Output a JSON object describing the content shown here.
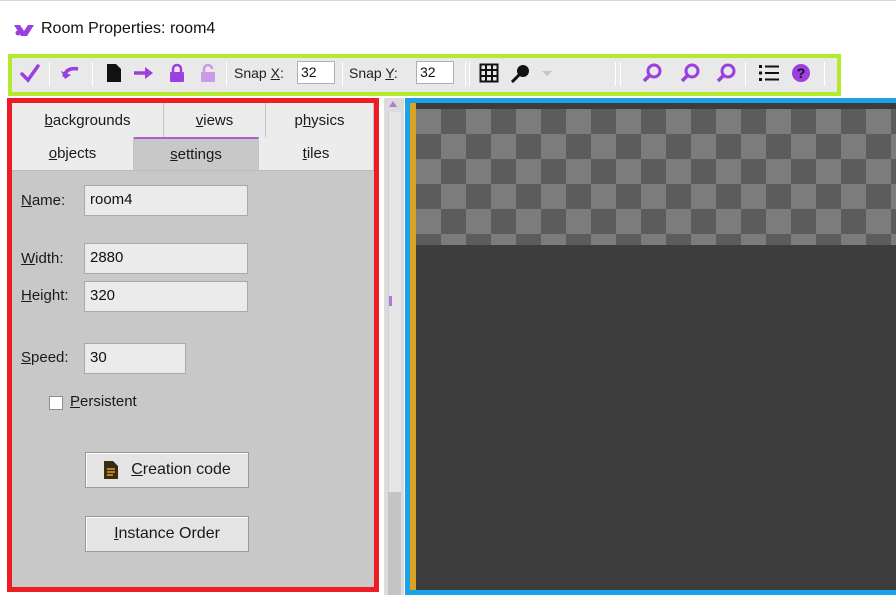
{
  "window": {
    "title": "Room Properties: room4"
  },
  "toolbar": {
    "buttons": [
      {
        "name": "ok-check-icon"
      },
      {
        "name": "undo-icon"
      },
      {
        "name": "clear-document-icon"
      },
      {
        "name": "shift-arrow-icon"
      },
      {
        "name": "lock-icon"
      },
      {
        "name": "unlock-icon"
      }
    ],
    "snap_x": {
      "label_pre": "Snap ",
      "label_key": "X",
      "label_post": ":",
      "value": "32"
    },
    "snap_y": {
      "label_pre": "Snap ",
      "label_key": "Y",
      "label_post": ":",
      "value": "32"
    },
    "grid_icon": "grid-icon",
    "zoom_icons": [
      "zoom-out-icon",
      "zoom-normal-icon",
      "zoom-in-icon"
    ],
    "list_icon": "list-icon",
    "help_icon": "help-icon",
    "accent": "#9b3fe0"
  },
  "tabs": {
    "row1": [
      {
        "pre": "",
        "key": "b",
        "post": "ackgrounds"
      },
      {
        "pre": "",
        "key": "v",
        "post": "iews"
      },
      {
        "pre": "p",
        "key": "h",
        "post": "ysics"
      }
    ],
    "row2": [
      {
        "pre": "",
        "key": "o",
        "post": "bjects"
      },
      {
        "pre": "",
        "key": "s",
        "post": "ettings"
      },
      {
        "pre": "",
        "key": "t",
        "post": "iles"
      }
    ],
    "active": "settings"
  },
  "settings": {
    "name_label": {
      "key": "N",
      "rest": "ame:"
    },
    "name_value": "room4",
    "width_label": {
      "key": "W",
      "rest": "idth:"
    },
    "width_value": "2880",
    "height_label": {
      "key": "H",
      "rest": "eight:"
    },
    "height_value": "320",
    "speed_label": {
      "key": "S",
      "rest": "peed:"
    },
    "speed_value": "30",
    "persistent_label": {
      "key": "P",
      "rest": "ersistent"
    },
    "persistent_checked": false,
    "creation_code_button": {
      "key": "C",
      "rest": "reation code"
    },
    "instance_order_button": {
      "key": "I",
      "rest": "nstance Order"
    }
  },
  "colors": {
    "toolbar_highlight": "#b4ea2b",
    "panel_highlight": "#ee1c25",
    "canvas_highlight": "#1aa3e8",
    "checker_light": "#7c7c7c",
    "checker_dark": "#5c5c5c",
    "room_background": "#3d3d3d"
  }
}
